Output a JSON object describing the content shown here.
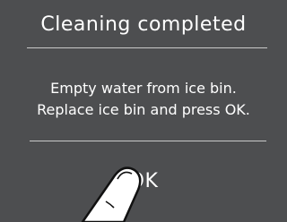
{
  "dialog": {
    "title": "Cleaning completed",
    "message_lines": [
      "Empty water from ice bin.",
      "Replace ice bin and press OK."
    ],
    "ok_label": "OK"
  },
  "colors": {
    "background": "#4d4e50",
    "text": "#ffffff",
    "divider": "#c9c9c9"
  },
  "icons": {
    "pointer": "finger-pointing-icon"
  }
}
